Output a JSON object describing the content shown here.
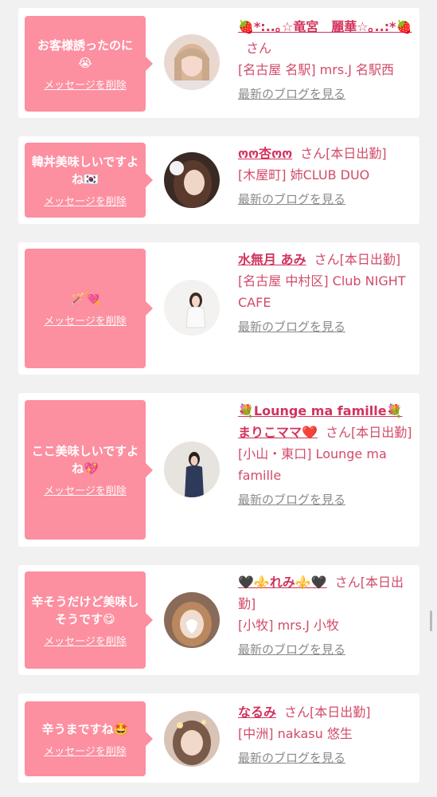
{
  "delete_label": "メッセージを削除",
  "blog_label": "最新のブログを見る",
  "san": "さん",
  "entries": [
    {
      "message": "お客様誘ったのに😭",
      "name": "🍓*:..｡☆竜宮　麗華☆｡..:*🍓",
      "status": "",
      "shop": "[名古屋 名駅] mrs.J 名駅西"
    },
    {
      "message": "韓丼美味しいですよね🇰🇷",
      "name": "ოო杏ოო",
      "status": "[本日出勤]",
      "shop": "[木屋町] 姉CLUB DUO"
    },
    {
      "message": "🪄💘",
      "name": "水無月 あみ",
      "status": "[本日出勤]",
      "shop": "[名古屋 中村区] Club NIGHT CAFE"
    },
    {
      "message": "ここ美味しいですよね💖",
      "name": "💐Lounge ma famille💐まりこママ❤️",
      "status": "[本日出勤]",
      "shop": "[小山・東口] Lounge ma famille"
    },
    {
      "message": "辛そうだけど美味しそうです😋",
      "name": "🖤⚜️れみ⚜️🖤",
      "status": "[本日出勤]",
      "shop": "[小牧] mrs.J 小牧"
    },
    {
      "message": "辛うまですね🤩",
      "name": "なるみ",
      "status": "[本日出勤]",
      "shop": "[中洲] nakasu 悠生"
    }
  ]
}
